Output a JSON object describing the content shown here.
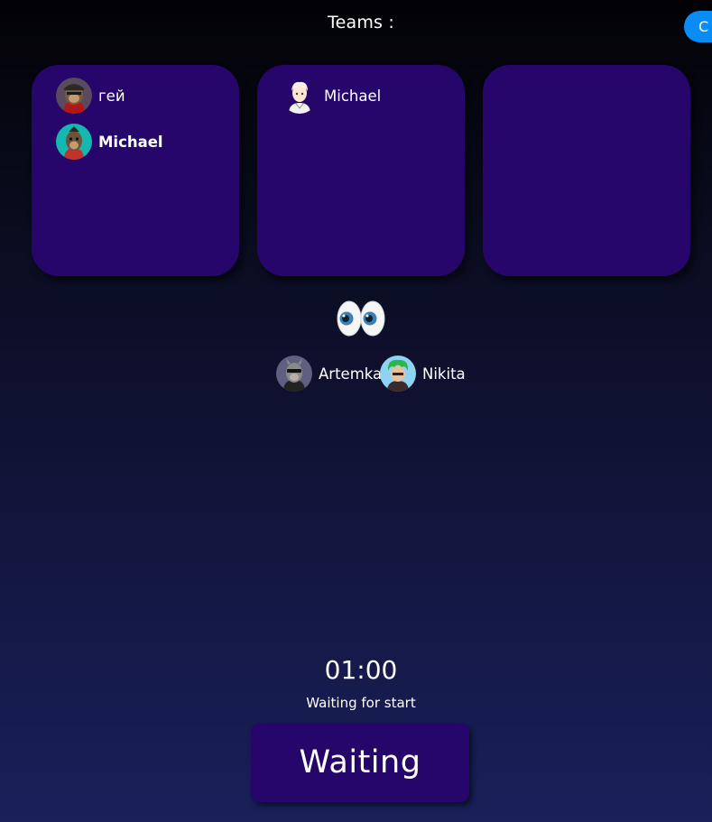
{
  "header": {
    "title": "Teams :",
    "corner_button_label": "C"
  },
  "teams": [
    {
      "players": [
        {
          "name": "гей",
          "avatar": "ape-avatar-red",
          "bold": false
        },
        {
          "name": "Michael",
          "avatar": "ape-avatar-teal",
          "bold": true
        }
      ]
    },
    {
      "players": [
        {
          "name": "Michael",
          "avatar": "anime-boy-avatar",
          "bold": false
        }
      ]
    },
    {
      "players": []
    }
  ],
  "spectators": {
    "icon": "eyes-icon",
    "players": [
      {
        "name": "Artemka",
        "avatar": "ape-avatar-gray"
      },
      {
        "name": "Nikita",
        "avatar": "green-hair-avatar"
      }
    ]
  },
  "footer": {
    "timer": "01:00",
    "status": "Waiting for start",
    "button_label": "Waiting"
  },
  "colors": {
    "card": "#26066a",
    "accent": "#0a8cf5"
  }
}
